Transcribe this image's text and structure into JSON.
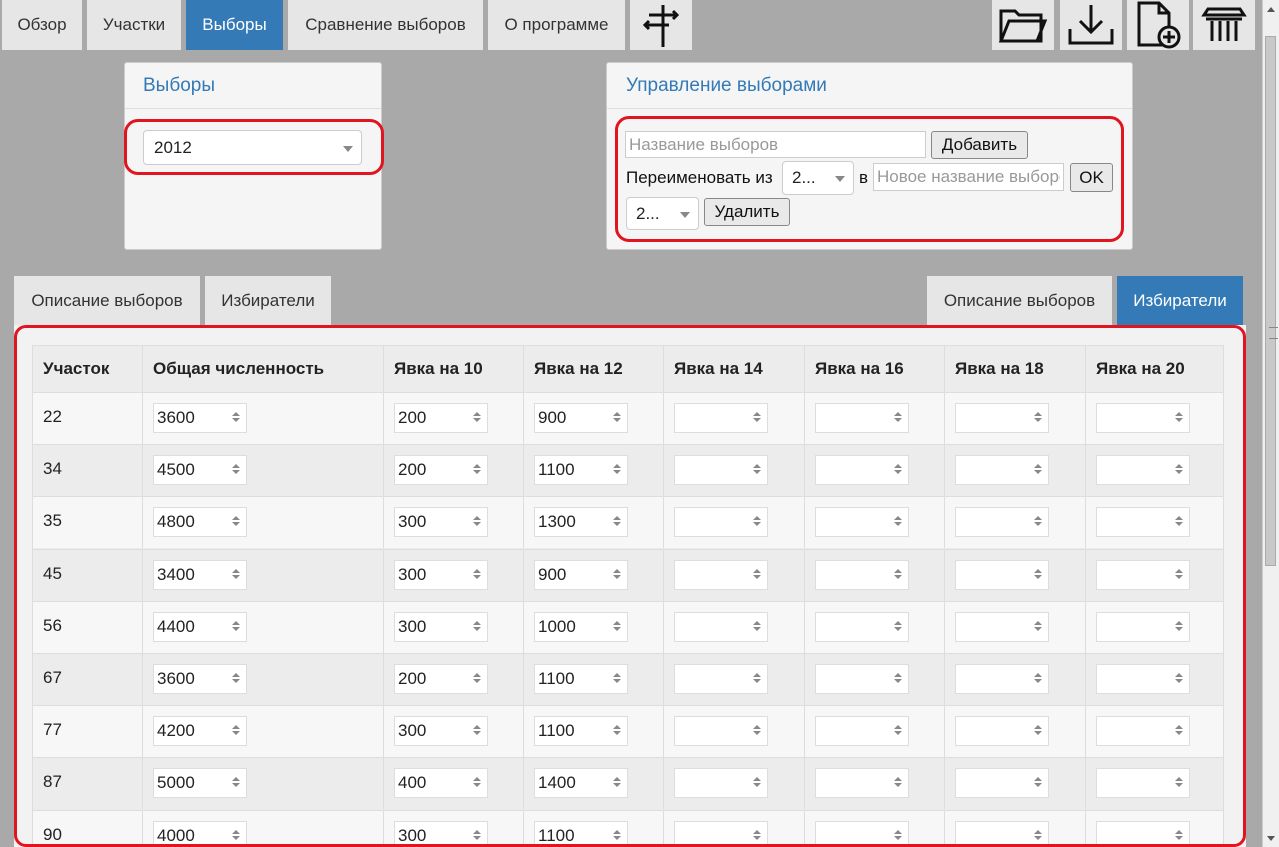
{
  "nav": {
    "tabs": [
      {
        "label": "Обзор",
        "active": false
      },
      {
        "label": "Участки",
        "active": false
      },
      {
        "label": "Выборы",
        "active": true
      },
      {
        "label": "Сравнение выборов",
        "active": false
      },
      {
        "label": "О программе",
        "active": false
      }
    ],
    "tools": [
      "fork-sign-icon",
      "open-folder-icon",
      "download-icon",
      "new-document-icon",
      "building-icon"
    ]
  },
  "elections_panel": {
    "title": "Выборы",
    "selected": "2012"
  },
  "manage_panel": {
    "title": "Управление выборами",
    "name_placeholder": "Название выборов",
    "add_label": "Добавить",
    "rename_label": "Переименовать из",
    "rename_from": "2...",
    "in_label": "в",
    "new_name_placeholder": "Новое название выборов",
    "ok_label": "OK",
    "delete_select": "2...",
    "delete_label": "Удалить"
  },
  "subtabs_left": [
    {
      "label": "Описание выборов",
      "active": false
    },
    {
      "label": "Избиратели",
      "active": false
    }
  ],
  "subtabs_right": [
    {
      "label": "Описание выборов",
      "active": false
    },
    {
      "label": "Избиратели",
      "active": true
    }
  ],
  "table": {
    "headers": [
      "Участок",
      "Общая численность",
      "Явка на 10",
      "Явка на 12",
      "Явка на 14",
      "Явка на 16",
      "Явка на 18",
      "Явка на 20"
    ],
    "rows": [
      {
        "id": "22",
        "total": "3600",
        "t10": "200",
        "t12": "900",
        "t14": "",
        "t16": "",
        "t18": "",
        "t20": ""
      },
      {
        "id": "34",
        "total": "4500",
        "t10": "200",
        "t12": "1100",
        "t14": "",
        "t16": "",
        "t18": "",
        "t20": ""
      },
      {
        "id": "35",
        "total": "4800",
        "t10": "300",
        "t12": "1300",
        "t14": "",
        "t16": "",
        "t18": "",
        "t20": ""
      },
      {
        "id": "45",
        "total": "3400",
        "t10": "300",
        "t12": "900",
        "t14": "",
        "t16": "",
        "t18": "",
        "t20": ""
      },
      {
        "id": "56",
        "total": "4400",
        "t10": "300",
        "t12": "1000",
        "t14": "",
        "t16": "",
        "t18": "",
        "t20": ""
      },
      {
        "id": "67",
        "total": "3600",
        "t10": "200",
        "t12": "1100",
        "t14": "",
        "t16": "",
        "t18": "",
        "t20": ""
      },
      {
        "id": "77",
        "total": "4200",
        "t10": "300",
        "t12": "1100",
        "t14": "",
        "t16": "",
        "t18": "",
        "t20": ""
      },
      {
        "id": "87",
        "total": "5000",
        "t10": "400",
        "t12": "1400",
        "t14": "",
        "t16": "",
        "t18": "",
        "t20": ""
      },
      {
        "id": "90",
        "total": "4000",
        "t10": "300",
        "t12": "1100",
        "t14": "",
        "t16": "",
        "t18": "",
        "t20": ""
      }
    ]
  },
  "colors": {
    "accent": "#337ab7",
    "highlight": "#e0151f",
    "background": "#a9a9a9"
  }
}
